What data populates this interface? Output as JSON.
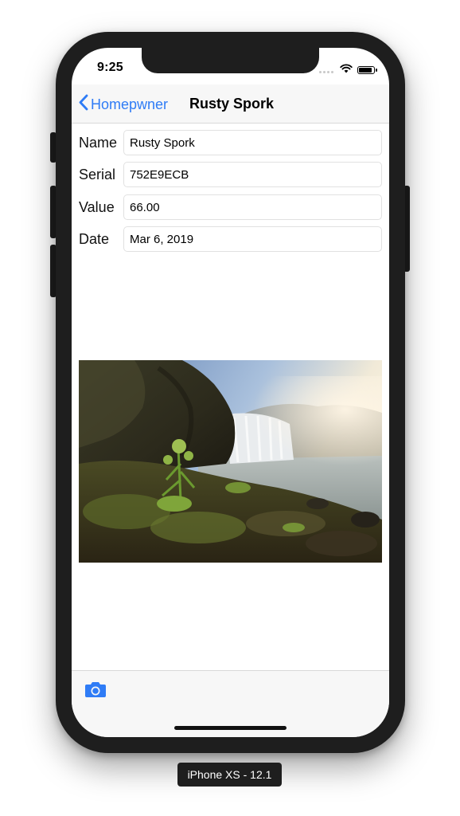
{
  "status_bar": {
    "time": "9:25"
  },
  "nav": {
    "back_label": "Homepwner",
    "title": "Rusty Spork"
  },
  "form": {
    "fields": [
      {
        "label": "Name",
        "value": "Rusty Spork"
      },
      {
        "label": "Serial",
        "value": "752E9ECB"
      },
      {
        "label": "Value",
        "value": "66.00"
      },
      {
        "label": "Date",
        "value": "Mar 6, 2019"
      }
    ]
  },
  "photo": {
    "subject": "waterfall landscape photo"
  },
  "toolbar": {
    "camera_icon": "camera-icon"
  },
  "device": {
    "label": "iPhone XS - 12.1"
  },
  "colors": {
    "tint": "#2f7cf6",
    "bar_background": "#f7f7f7",
    "frame": "#1e1e1e"
  }
}
